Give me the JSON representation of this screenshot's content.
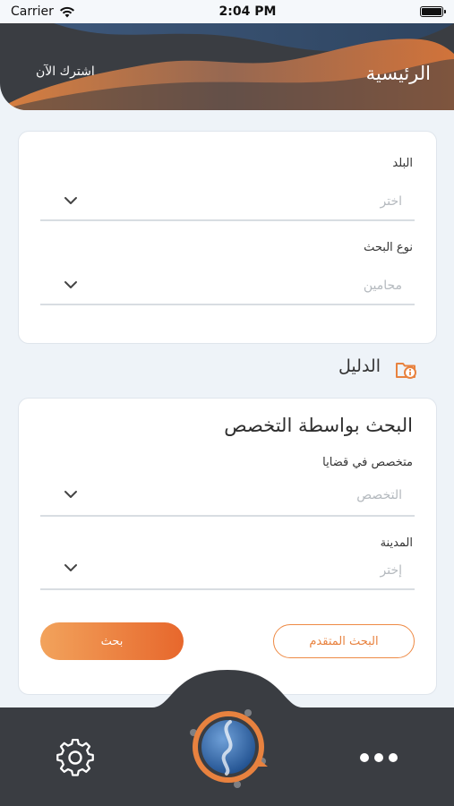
{
  "status_bar": {
    "carrier": "Carrier",
    "time": "2:04 PM"
  },
  "header": {
    "title": "الرئيسية",
    "subscribe": "اشترك الآن"
  },
  "filters": {
    "country": {
      "label": "البلد",
      "placeholder": "اختر"
    },
    "search_type": {
      "label": "نوع البحث",
      "placeholder": "محامين"
    }
  },
  "directory": {
    "title": "الدليل",
    "card": {
      "heading": "البحث بواسطة التخصص",
      "specialty": {
        "label": "متخصص في قضايا",
        "placeholder": "التخصص"
      },
      "city": {
        "label": "المدينة",
        "placeholder": "إختر"
      },
      "advanced_button": "البحث المتقدم",
      "search_button": "بحث"
    }
  },
  "icons": [
    "wifi-icon",
    "battery-icon",
    "chevron-down-icon",
    "folder-info-icon",
    "gear-icon",
    "logo-icon",
    "more-icon"
  ],
  "colors": {
    "accent": "#e8823f",
    "dark": "#3a3d42",
    "background": "#eef3f8"
  }
}
